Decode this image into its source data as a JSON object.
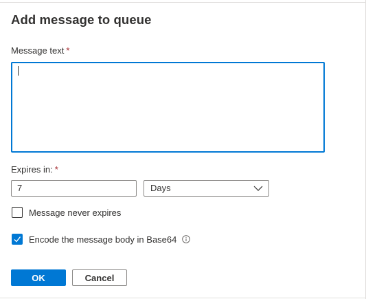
{
  "dialog": {
    "title": "Add message to queue",
    "message_text_label": "Message text",
    "required_marker": "*",
    "message_text_value": "",
    "expires_label": "Expires in:",
    "expires_value": "7",
    "expires_unit": "Days",
    "never_expires_label": "Message never expires",
    "never_expires_checked": false,
    "encode_base64_label": "Encode the message body in Base64",
    "encode_base64_checked": true,
    "ok_label": "OK",
    "cancel_label": "Cancel"
  },
  "colors": {
    "accent": "#0078d4",
    "required": "#a4262c",
    "text": "#323130",
    "border": "#8a8886"
  },
  "icons": {
    "dropdown": "chevron-down-icon",
    "checkbox_check": "checkmark-icon",
    "info": "info-icon"
  }
}
